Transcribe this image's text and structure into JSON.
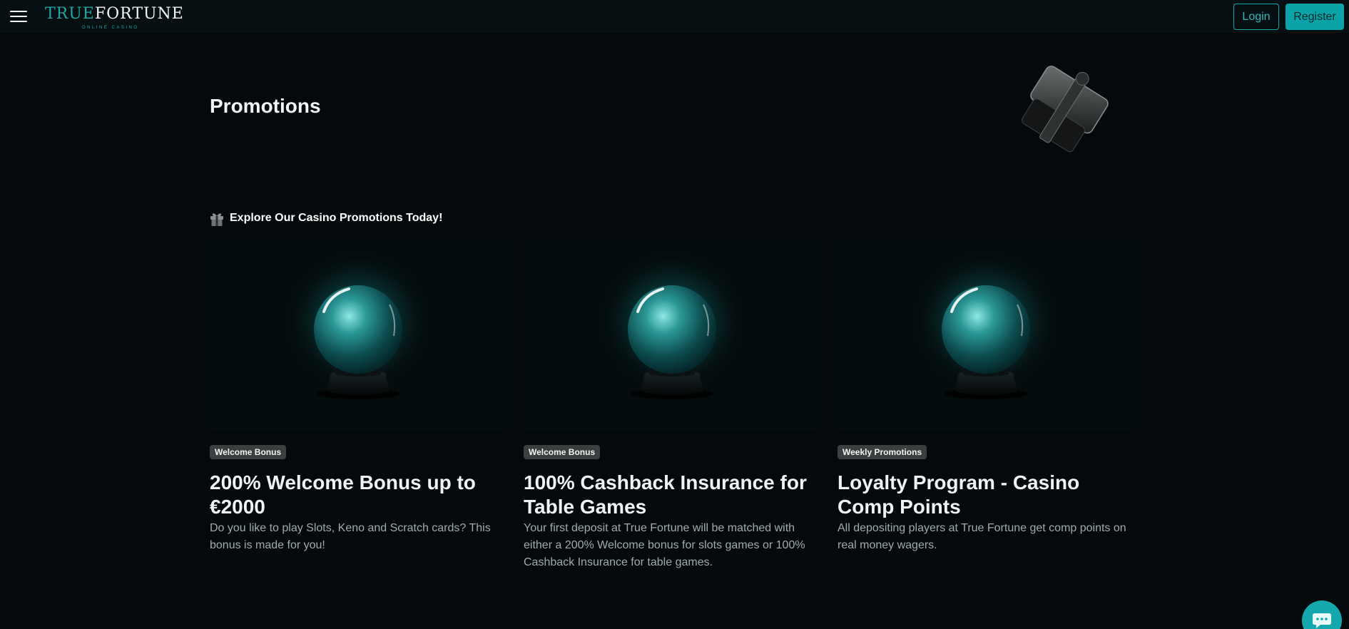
{
  "header": {
    "logo": {
      "word1": "TRUE",
      "word2": "FORTUNE",
      "tagline": "ONLINE CASINO"
    },
    "login_label": "Login",
    "register_label": "Register"
  },
  "hero": {
    "title": "Promotions"
  },
  "section": {
    "heading": "Explore Our Casino Promotions Today!"
  },
  "promotions": [
    {
      "badge": "Welcome Bonus",
      "title": "200% Welcome Bonus up to €2000",
      "description": "Do you like to play Slots, Keno and Scratch cards? This bonus is made for you!"
    },
    {
      "badge": "Welcome Bonus",
      "title": "100% Cashback Insurance for Table Games",
      "description": "Your first deposit at True Fortune will be matched with either a 200% Welcome bonus for slots games or 100% Cashback Insurance for table games."
    },
    {
      "badge": "Weekly Promotions",
      "title": "Loyalty Program - Casino Comp Points",
      "description": "All depositing players at True Fortune get comp points on real money wagers."
    }
  ],
  "colors": {
    "background": "#040a0b",
    "accent": "#0aa4a8",
    "badge": "#3b3f40"
  }
}
